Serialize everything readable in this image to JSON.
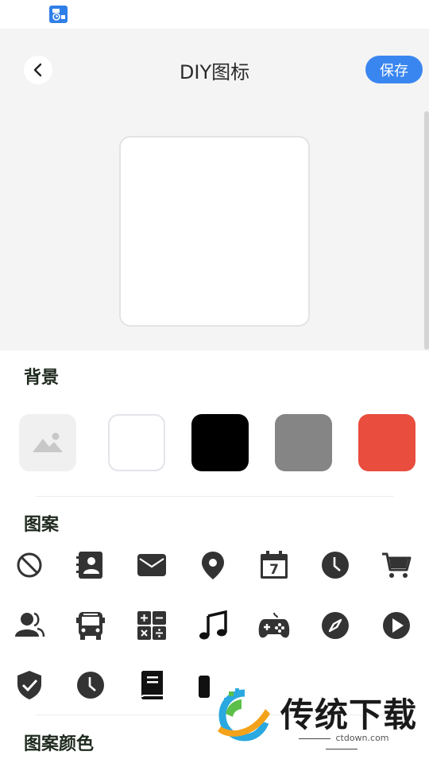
{
  "header": {
    "title": "DIY图标",
    "save_label": "保存"
  },
  "sections": {
    "background": "背景",
    "pattern": "图案",
    "pattern_color": "图案颜色"
  },
  "background_swatches": [
    {
      "name": "image",
      "color": "#f0f0f0"
    },
    {
      "name": "white",
      "color": "#ffffff"
    },
    {
      "name": "black",
      "color": "#000000"
    },
    {
      "name": "gray",
      "color": "#858585"
    },
    {
      "name": "red",
      "color": "#e84d3d"
    }
  ],
  "patterns": [
    "prohibited-icon",
    "contact-book-icon",
    "mail-icon",
    "location-pin-icon",
    "calendar-icon",
    "clock-icon",
    "cart-icon",
    "users-icon",
    "bus-icon",
    "calculator-icon",
    "music-note-icon",
    "gamepad-icon",
    "compass-icon",
    "play-icon",
    "shield-check-icon",
    "clock-icon",
    "book-icon"
  ],
  "calendar_day": "7",
  "watermark": {
    "title": "传统下载",
    "url": "ctdown.com"
  },
  "colors": {
    "accent": "#3a86f0",
    "icon": "#333333"
  }
}
